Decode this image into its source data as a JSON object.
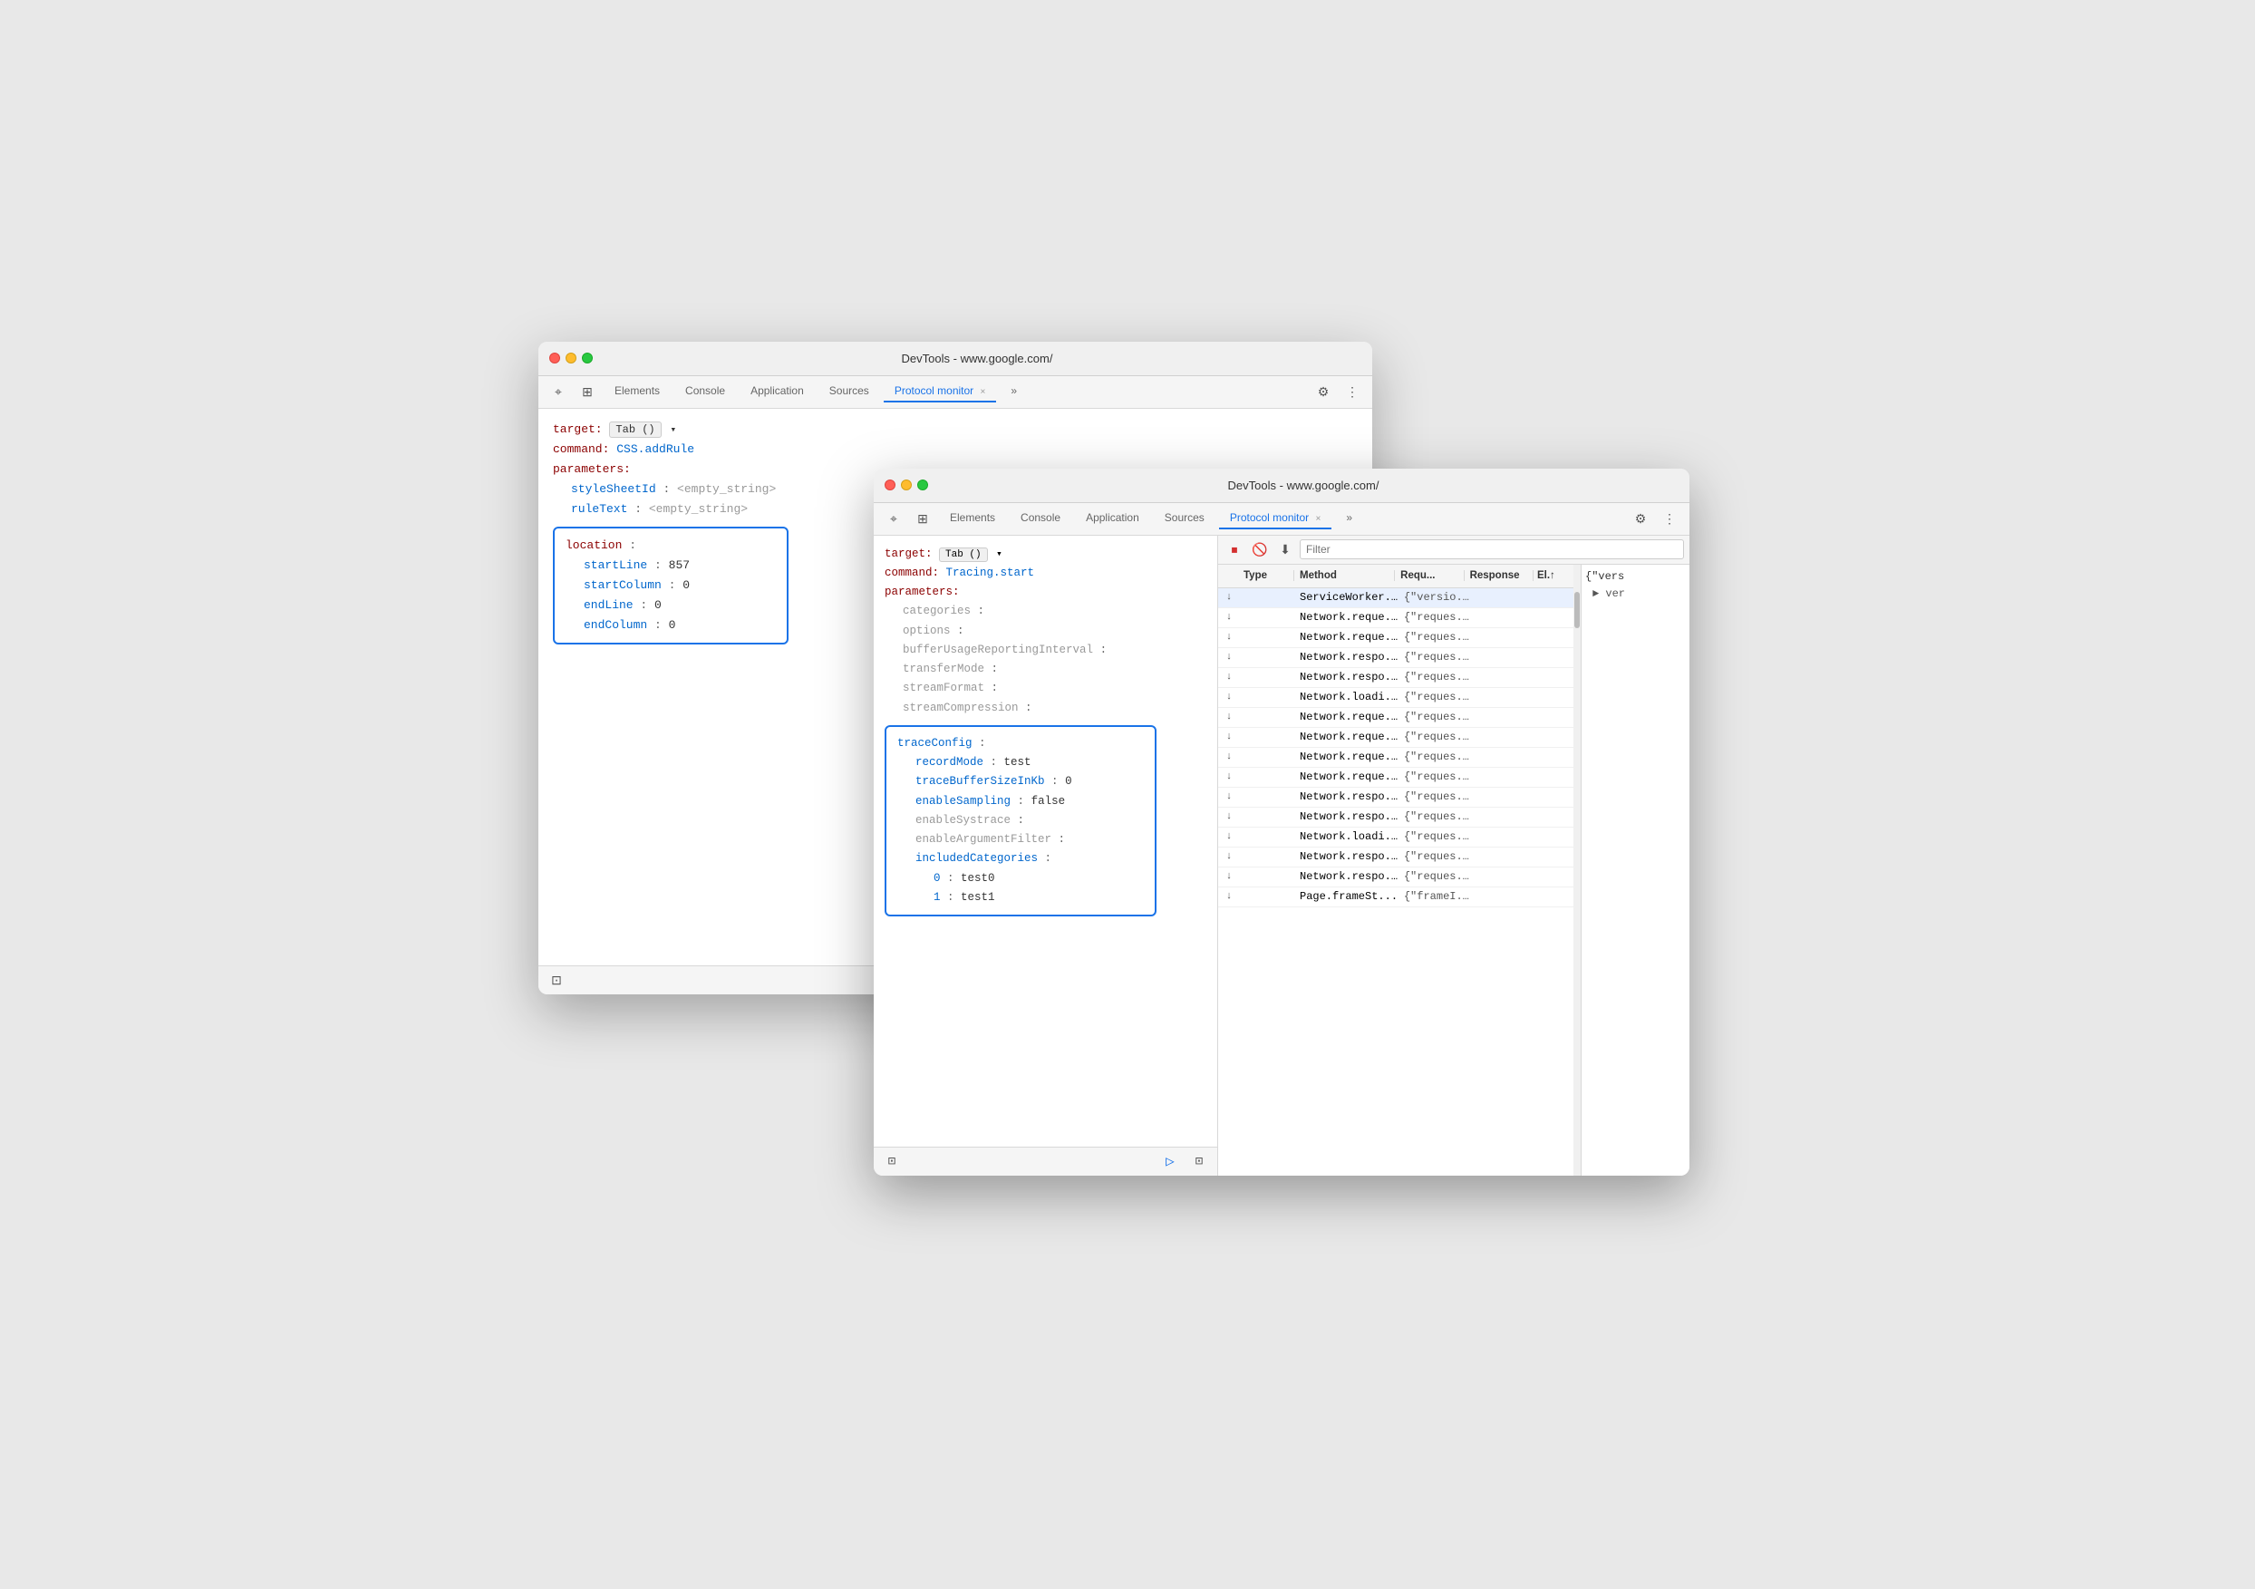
{
  "back_window": {
    "title": "DevTools - www.google.com/",
    "tabs": [
      {
        "label": "Elements",
        "active": false
      },
      {
        "label": "Console",
        "active": false
      },
      {
        "label": "Application",
        "active": false
      },
      {
        "label": "Sources",
        "active": false
      },
      {
        "label": "Protocol monitor",
        "active": true
      },
      {
        "label": "×",
        "active": false
      }
    ],
    "target_label": "target:",
    "target_value": "Tab ()",
    "command_label": "command:",
    "command_value": "CSS.addRule",
    "params_label": "parameters:",
    "param1_key": "styleSheetId",
    "param1_value": "<empty_string>",
    "param2_key": "ruleText",
    "param2_value": "<empty_string>",
    "location_label": "location",
    "loc_p1_key": "startLine",
    "loc_p1_val": "857",
    "loc_p2_key": "startColumn",
    "loc_p2_val": "0",
    "loc_p3_key": "endLine",
    "loc_p3_val": "0",
    "loc_p4_key": "endColumn",
    "loc_p4_val": "0"
  },
  "front_window": {
    "title": "DevTools - www.google.com/",
    "tabs": [
      {
        "label": "Elements",
        "active": false
      },
      {
        "label": "Console",
        "active": false
      },
      {
        "label": "Application",
        "active": false
      },
      {
        "label": "Sources",
        "active": false
      },
      {
        "label": "Protocol monitor",
        "active": true
      }
    ],
    "target_label": "target:",
    "target_value": "Tab ()",
    "command_label": "command:",
    "command_value": "Tracing.start",
    "params_label": "parameters:",
    "categories_label": "categories",
    "options_label": "options",
    "buffer_label": "bufferUsageReportingInterval",
    "transfer_label": "transferMode",
    "stream_format_label": "streamFormat",
    "stream_compression_label": "streamCompression",
    "trace_config_label": "traceConfig",
    "record_mode_key": "recordMode",
    "record_mode_val": "test",
    "trace_buf_key": "traceBufferSizeInKb",
    "trace_buf_val": "0",
    "enable_sampling_key": "enableSampling",
    "enable_sampling_val": "false",
    "enable_systrace_key": "enableSystrace",
    "enable_arg_key": "enableArgumentFilter",
    "included_cats_key": "includedCategories",
    "item0_key": "0",
    "item0_val": "test0",
    "item1_key": "1",
    "item1_val": "test1",
    "filter_placeholder": "Filter",
    "table": {
      "headers": [
        "Type",
        "Method",
        "Requ...",
        "Response",
        "El.↑"
      ],
      "rows": [
        {
          "arrow": "↓",
          "type": "",
          "method": "ServiceWorker...",
          "requ": "{\"versio...",
          "response": "",
          "el": "",
          "selected": true
        },
        {
          "arrow": "↓",
          "type": "",
          "method": "Network.reque...",
          "requ": "{\"reques...",
          "response": "",
          "el": ""
        },
        {
          "arrow": "↓",
          "type": "",
          "method": "Network.reque...",
          "requ": "{\"reques...",
          "response": "",
          "el": ""
        },
        {
          "arrow": "↓",
          "type": "",
          "method": "Network.respo...",
          "requ": "{\"reques...",
          "response": "",
          "el": ""
        },
        {
          "arrow": "↓",
          "type": "",
          "method": "Network.respo...",
          "requ": "{\"reques...",
          "response": "",
          "el": ""
        },
        {
          "arrow": "↓",
          "type": "",
          "method": "Network.loadi...",
          "requ": "{\"reques...",
          "response": "",
          "el": ""
        },
        {
          "arrow": "↓",
          "type": "",
          "method": "Network.reque...",
          "requ": "{\"reques...",
          "response": "",
          "el": ""
        },
        {
          "arrow": "↓",
          "type": "",
          "method": "Network.reque...",
          "requ": "{\"reques...",
          "response": "",
          "el": ""
        },
        {
          "arrow": "↓",
          "type": "",
          "method": "Network.reque...",
          "requ": "{\"reques...",
          "response": "",
          "el": ""
        },
        {
          "arrow": "↓",
          "type": "",
          "method": "Network.reque...",
          "requ": "{\"reques...",
          "response": "",
          "el": ""
        },
        {
          "arrow": "↓",
          "type": "",
          "method": "Network.respo...",
          "requ": "{\"reques...",
          "response": "",
          "el": ""
        },
        {
          "arrow": "↓",
          "type": "",
          "method": "Network.respo...",
          "requ": "{\"reques...",
          "response": "",
          "el": ""
        },
        {
          "arrow": "↓",
          "type": "",
          "method": "Network.loadi...",
          "requ": "{\"reques...",
          "response": "",
          "el": ""
        },
        {
          "arrow": "↓",
          "type": "",
          "method": "Network.respo...",
          "requ": "{\"reques...",
          "response": "",
          "el": ""
        },
        {
          "arrow": "↓",
          "type": "",
          "method": "Network.respo...",
          "requ": "{\"reques...",
          "response": "",
          "el": ""
        },
        {
          "arrow": "↓",
          "type": "",
          "method": "Page.frameSt...",
          "requ": "{\"frameI...",
          "response": "",
          "el": ""
        }
      ]
    },
    "tree_content": "{\"vers",
    "tree_sub": "► ver"
  },
  "icons": {
    "record_stop": "⏹",
    "clear": "🚫",
    "download": "⬇",
    "more": "›",
    "chevron_down": "▾",
    "send": "▷",
    "dock": "⊡",
    "dots": "⋮",
    "gear": "⚙",
    "cursor": "⌖",
    "layers": "⊞"
  }
}
